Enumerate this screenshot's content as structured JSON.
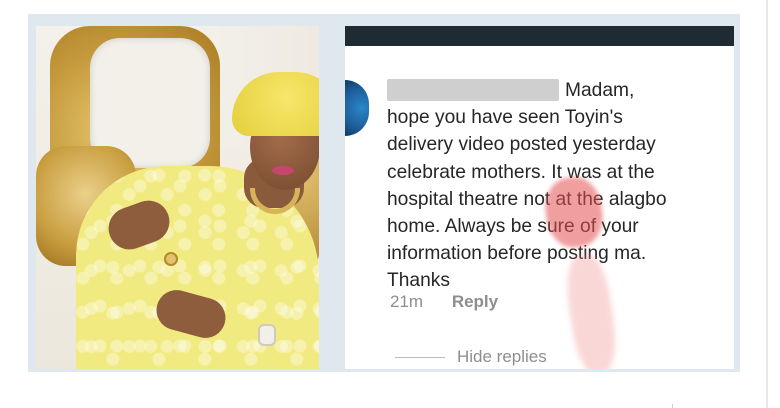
{
  "comment": {
    "text": "Madam,\nhope you have seen Toyin's\ndelivery video posted yesterday\ncelebrate mothers. It was at the\nhospital theatre not at the alagbo\nhome. Always be sure of your\ninformation before posting ma.\nThanks",
    "time": "21m",
    "reply_label": "Reply",
    "hide_replies_label": "Hide replies"
  },
  "colors": {
    "frame": "#dfe8ef",
    "dress": "#f1ea80",
    "headwrap": "#f7e66a",
    "text": "#262626",
    "meta": "#8e8e8e",
    "watermark": "#e45050"
  },
  "icons": {
    "avatar": "profile-avatar",
    "redaction": "blurred-username"
  }
}
